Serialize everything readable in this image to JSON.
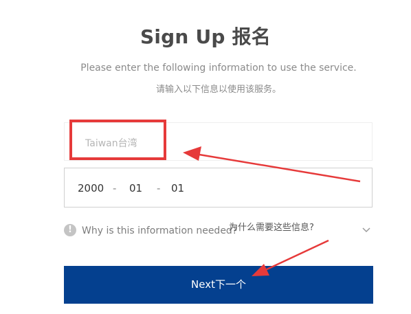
{
  "page": {
    "title": "Sign Up 报名",
    "subtitle_en": "Please enter the following information to use the service.",
    "subtitle_cn": "请输入以下信息以使用该服务。"
  },
  "form": {
    "country_value": "Taiwan台湾",
    "birth": {
      "year": "2000",
      "month": "01",
      "day": "01",
      "separator": "-"
    },
    "why_label": "Why is this information needed?",
    "why_label_cn": "为什么需要这些信息?",
    "info_icon": "info-icon",
    "chevron_icon": "chevron-down-icon"
  },
  "button": {
    "next_label": "Next下一个"
  },
  "colors": {
    "primary": "#04408f",
    "annotation_red": "#e63a3a",
    "muted_text": "#8a8a8a"
  }
}
